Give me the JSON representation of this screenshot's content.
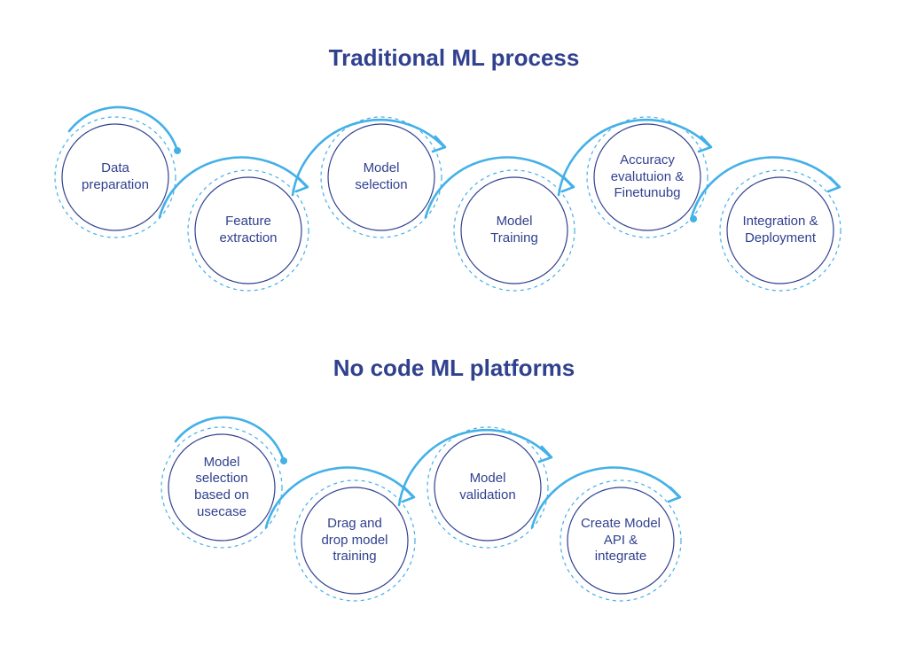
{
  "section1": {
    "title": "Traditional ML process",
    "nodes": [
      {
        "label": "Data\npreparation"
      },
      {
        "label": "Feature\nextraction"
      },
      {
        "label": "Model\nselection"
      },
      {
        "label": "Model\nTraining"
      },
      {
        "label": "Accuracy\nevalutuion &\nFinetunubg"
      },
      {
        "label": "Integration &\nDeployment"
      }
    ]
  },
  "section2": {
    "title": "No code ML platforms",
    "nodes": [
      {
        "label": "Model\nselection\nbased on\nusecase"
      },
      {
        "label": "Drag and\ndrop model\ntraining"
      },
      {
        "label": "Model\nvalidation"
      },
      {
        "label": "Create Model\nAPI &\nintegrate"
      }
    ]
  },
  "colors": {
    "title": "#30418f",
    "nodeStroke": "#30418f",
    "accent": "#43b0e8"
  }
}
